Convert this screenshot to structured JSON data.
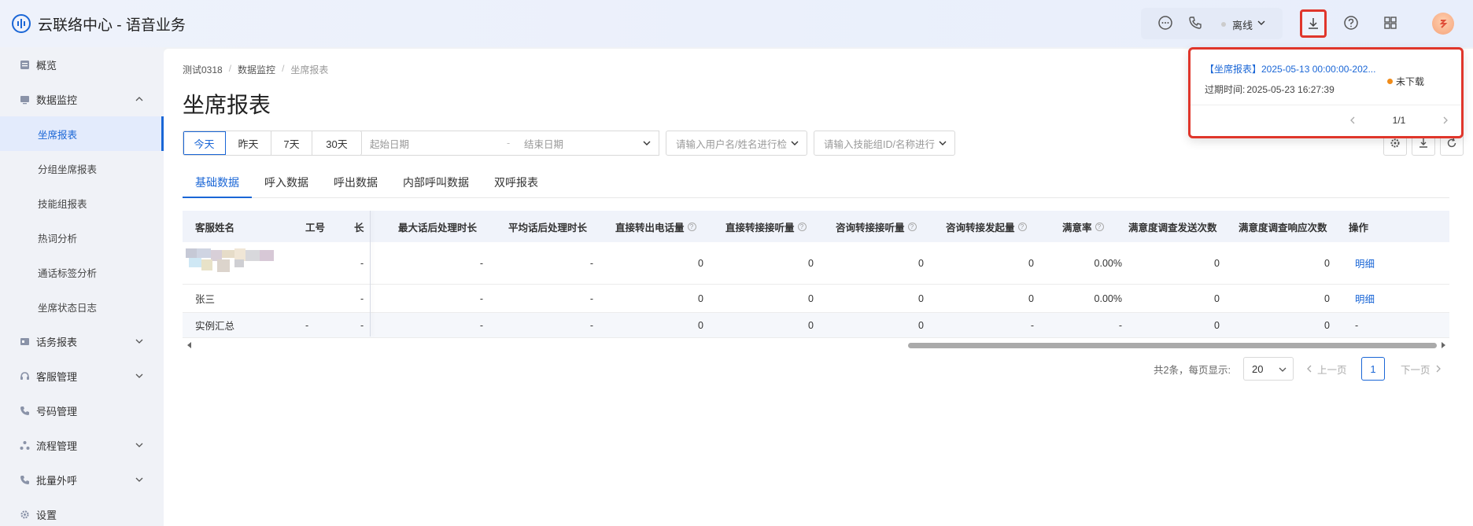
{
  "header": {
    "title": "云联络中心 - 语音业务",
    "status_text": "离线",
    "colors": {
      "accent": "#1a66d6",
      "highlight": "#e0362b"
    },
    "icons": [
      "chat-icon",
      "phone-icon",
      "download-icon",
      "help-icon",
      "apps-grid-icon"
    ]
  },
  "sidebar": {
    "items": [
      {
        "label": "概览",
        "icon": "overview-icon"
      },
      {
        "label": "数据监控",
        "icon": "monitor-icon",
        "expanded": true
      },
      {
        "label": "坐席报表",
        "sub": true,
        "active": true
      },
      {
        "label": "分组坐席报表",
        "sub": true
      },
      {
        "label": "技能组报表",
        "sub": true
      },
      {
        "label": "热词分析",
        "sub": true
      },
      {
        "label": "通话标签分析",
        "sub": true
      },
      {
        "label": "坐席状态日志",
        "sub": true
      },
      {
        "label": "话务报表",
        "icon": "traffic-report-icon"
      },
      {
        "label": "客服管理",
        "icon": "headset-icon"
      },
      {
        "label": "号码管理",
        "icon": "phone-number-icon"
      },
      {
        "label": "流程管理",
        "icon": "flow-icon"
      },
      {
        "label": "批量外呼",
        "icon": "batch-call-icon"
      },
      {
        "label": "设置",
        "icon": "settings-icon"
      }
    ]
  },
  "breadcrumb": [
    "测试0318",
    "数据监控",
    "坐席报表"
  ],
  "page_title": "坐席报表",
  "filters": {
    "quick_ranges": [
      "今天",
      "昨天",
      "7天",
      "30天"
    ],
    "active_range": "今天",
    "start_date_placeholder": "起始日期",
    "date_sep": "-",
    "end_date_placeholder": "结束日期",
    "user_placeholder": "请输入用户名/姓名进行检",
    "skill_placeholder": "请输入技能组ID/名称进行"
  },
  "tabs": [
    "基础数据",
    "呼入数据",
    "呼出数据",
    "内部呼叫数据",
    "双呼报表"
  ],
  "table": {
    "columns": [
      "客服姓名",
      "工号",
      "长",
      "最大话后处理时长",
      "平均话后处理时长",
      "直接转出电话量",
      "直接转接接听量",
      "咨询转接接听量",
      "咨询转接发起量",
      "满意率",
      "满意度调查发送次数",
      "满意度调查响应次数",
      "操作"
    ],
    "rows": [
      [
        "",
        "",
        "-",
        "-",
        "-",
        "0",
        "0",
        "0",
        "0",
        "0.00%",
        "0",
        "0",
        "明细"
      ],
      [
        "张三",
        "",
        "-",
        "-",
        "-",
        "0",
        "0",
        "0",
        "0",
        "0.00%",
        "0",
        "0",
        "明细"
      ],
      [
        "实例汇总",
        "-",
        "-",
        "-",
        "-",
        "0",
        "0",
        "0",
        "-",
        "-",
        "0",
        "0",
        "-"
      ]
    ]
  },
  "pagination": {
    "total_text": "共2条，每页显示:",
    "page_size": "20",
    "prev": "上一页",
    "current": "1",
    "next": "下一页"
  },
  "download_popover": {
    "task_title": "【坐席报表】2025-05-13 00:00:00-202...",
    "expire_label": "过期时间:",
    "expire_value": "2025-05-23 16:27:39",
    "status": "未下载",
    "page_indicator": "1/1"
  }
}
